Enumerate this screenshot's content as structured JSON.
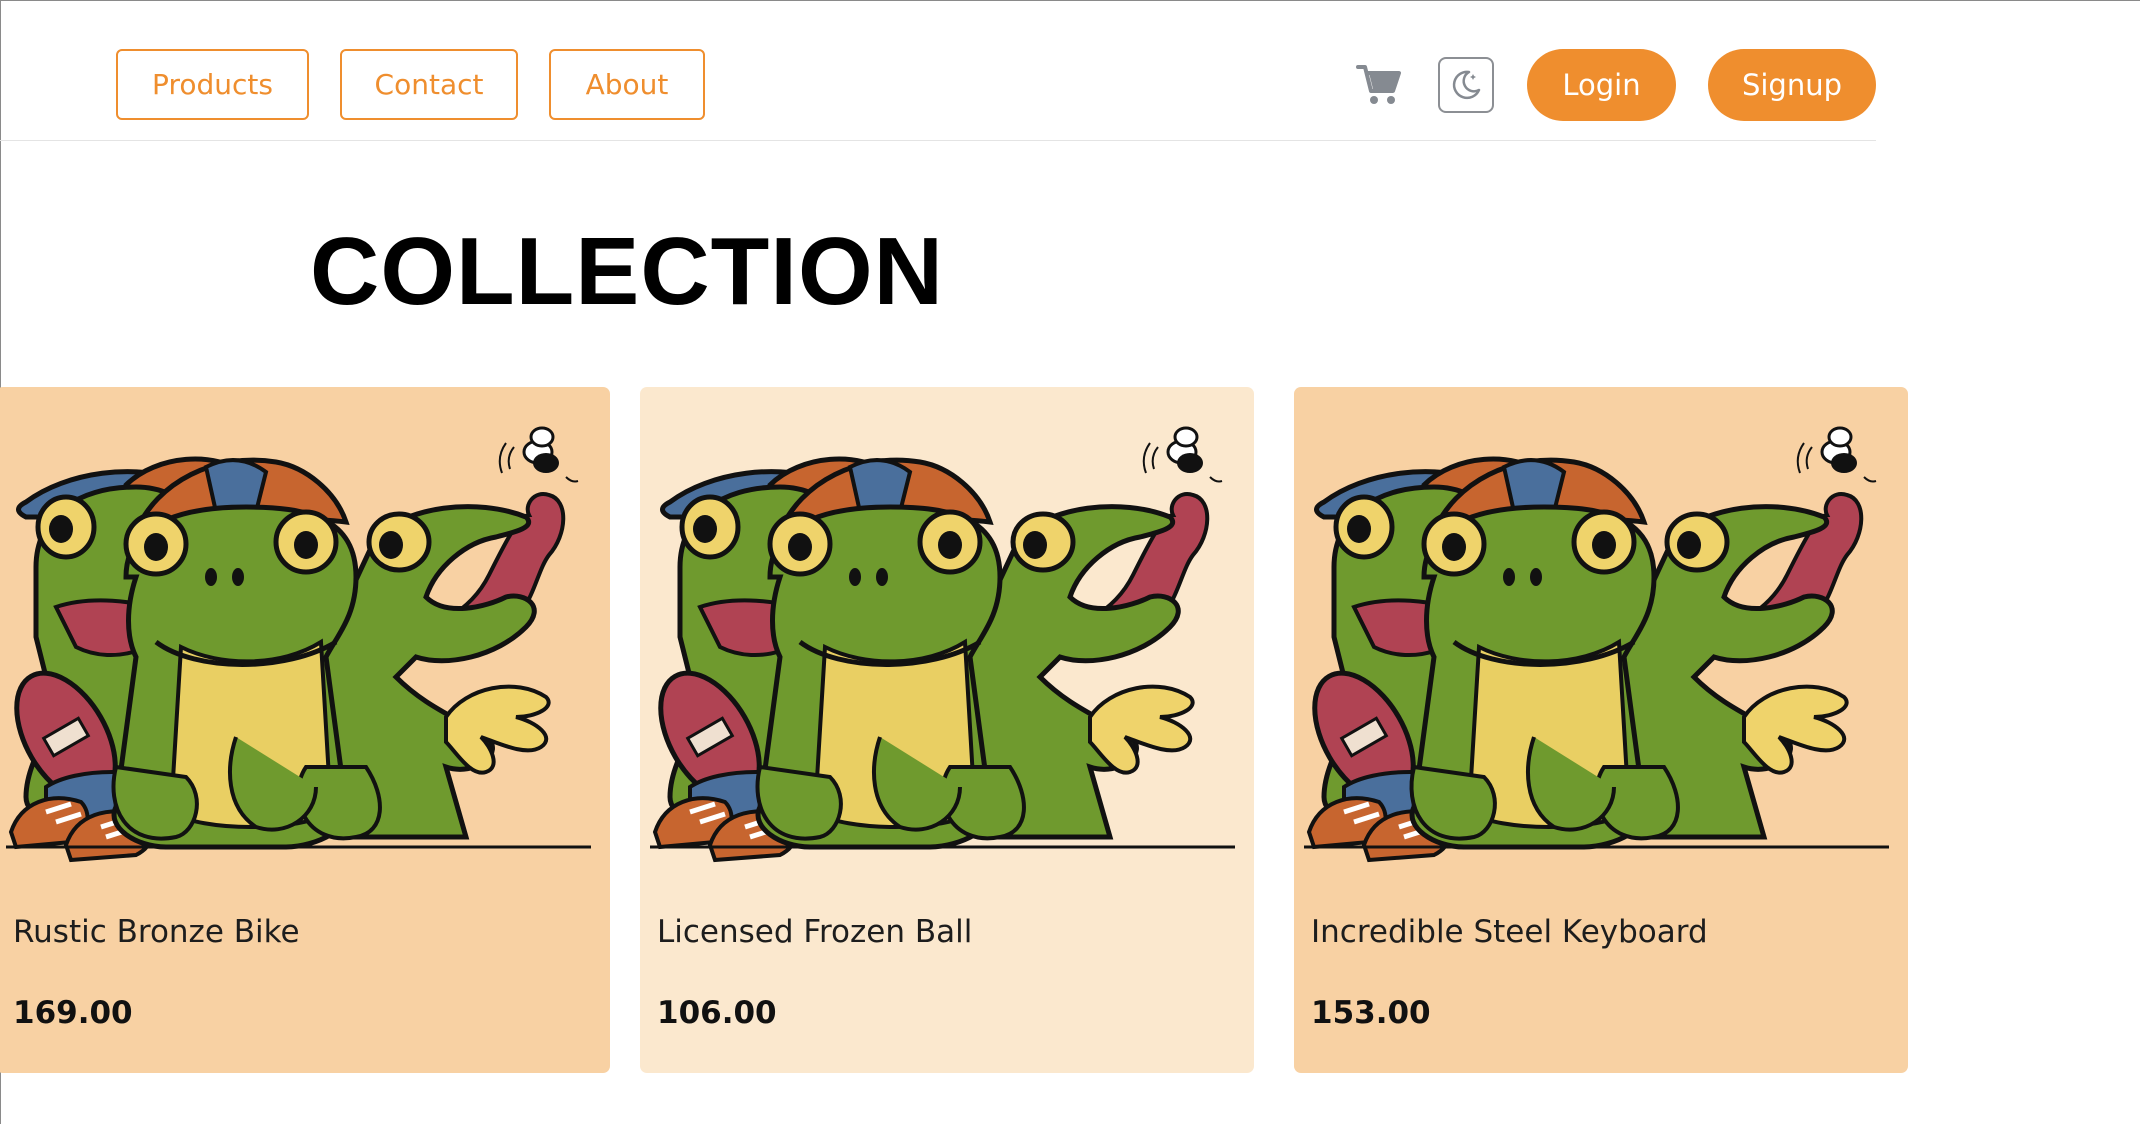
{
  "nav": {
    "links": [
      {
        "label": "Products"
      },
      {
        "label": "Contact"
      },
      {
        "label": "About"
      }
    ],
    "cart_icon": "shopping-cart-icon",
    "theme_icon": "moon-icon",
    "login_label": "Login",
    "signup_label": "Signup"
  },
  "page_title": "COLLECTION",
  "products": [
    {
      "name": "Rustic Bronze Bike",
      "price": "169.00",
      "bg": "#f8d1a3"
    },
    {
      "name": "Licensed Frozen Ball",
      "price": "106.00",
      "bg": "#fbe8ce"
    },
    {
      "name": "Incredible Steel Keyboard",
      "price": "153.00",
      "bg": "#f8d1a3"
    }
  ],
  "colors": {
    "accent": "#ef8e2e",
    "frog_green": "#6f9a2e",
    "frog_belly": "#e9cf63",
    "cap_blue": "#4a6f9c",
    "cap_orange": "#c7652f",
    "tongue": "#b04353"
  }
}
